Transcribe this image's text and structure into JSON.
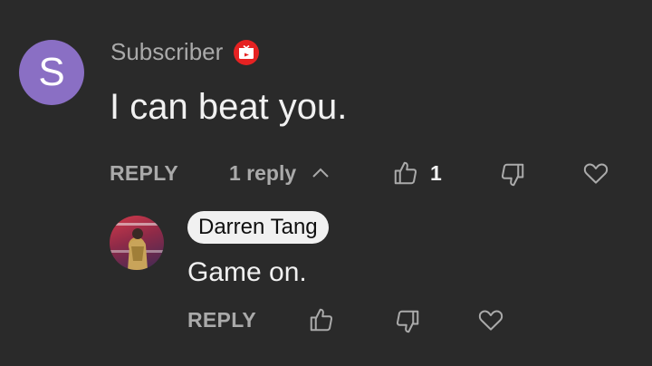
{
  "comment": {
    "avatar_letter": "S",
    "avatar_color": "#8a6fc4",
    "author": "Subscriber",
    "badge_icon": "youtube-gift-badge-icon",
    "badge_color": "#e52222",
    "text": "I can beat you.",
    "reply_label": "REPLY",
    "replies_label": "1 reply",
    "like_count": "1"
  },
  "reply": {
    "author": "Darren Tang",
    "text": "Game on.",
    "reply_label": "REPLY"
  },
  "icons": {
    "like": "thumb-up-icon",
    "dislike": "thumb-down-icon",
    "heart": "heart-icon",
    "collapse": "chevron-up-icon"
  }
}
